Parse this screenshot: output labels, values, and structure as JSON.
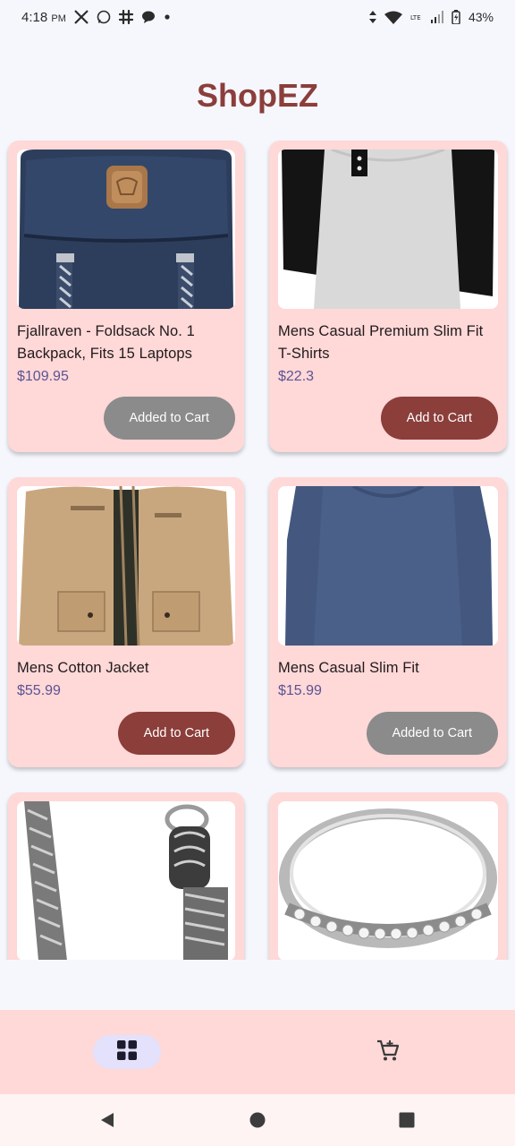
{
  "status_bar": {
    "time": "4:18",
    "ampm": "PM",
    "battery": "43%",
    "icons": [
      "x-icon",
      "whatsapp-icon",
      "slack-icon",
      "chat-icon",
      "dot-icon",
      "data-arrows-icon",
      "wifi-icon",
      "lte-icon",
      "signal-icon",
      "battery-icon"
    ]
  },
  "app": {
    "title": "ShopEZ"
  },
  "products": [
    {
      "title": "Fjallraven - Foldsack No. 1 Backpack, Fits 15 Laptops",
      "price": "$109.95",
      "button": "Added to Cart",
      "image": "backpack"
    },
    {
      "title": "Mens Casual Premium Slim Fit T-Shirts",
      "price": "$22.3",
      "button": "Add to Cart",
      "image": "raglan-tshirt"
    },
    {
      "title": "Mens Cotton Jacket",
      "price": "$55.99",
      "button": "Add to Cart",
      "image": "jacket"
    },
    {
      "title": "Mens Casual Slim Fit",
      "price": "$15.99",
      "button": "Added to Cart",
      "image": "long-sleeve-shirt"
    },
    {
      "title": "",
      "price": "",
      "button": "",
      "image": "chain-bracelet"
    },
    {
      "title": "",
      "price": "",
      "button": "",
      "image": "diamond-ring"
    }
  ],
  "bottom_nav": {
    "items": [
      "grid-icon",
      "cart-icon"
    ],
    "selected": "grid-icon"
  },
  "system_nav": {
    "items": [
      "back-icon",
      "home-icon",
      "recents-icon"
    ]
  },
  "colors": {
    "accent": "#8b3e3a",
    "card": "#ffd8d8",
    "price": "#5b5394",
    "added_button": "#8b8b8b",
    "nav_pill": "#e3e1fb"
  }
}
